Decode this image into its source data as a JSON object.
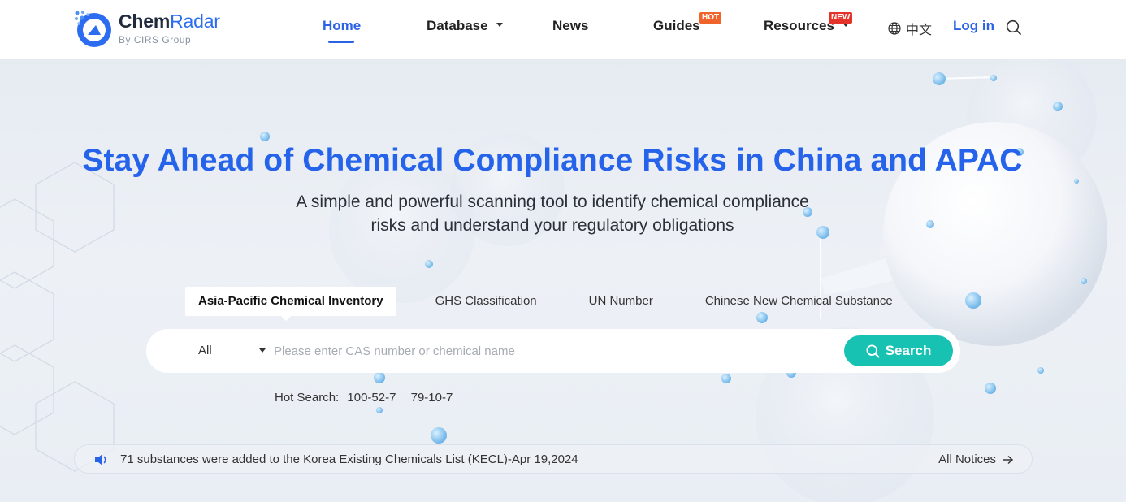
{
  "header": {
    "logo": {
      "name_bold": "Chem",
      "name_light": "Radar",
      "sub": "By CIRS Group"
    },
    "nav": {
      "home": "Home",
      "database": "Database",
      "news": "News",
      "guides": "Guides",
      "resources": "Resources"
    },
    "badges": {
      "hot": "HOT",
      "new": "NEW"
    },
    "language": "中文",
    "login": "Log in",
    "icons": {
      "globe": "globe-icon",
      "search": "search-icon",
      "dropdown": "chevron-down-icon"
    }
  },
  "hero": {
    "title": "Stay Ahead of Chemical Compliance Risks in China and APAC",
    "subtitle_line1": "A simple and powerful scanning tool to identify chemical compliance",
    "subtitle_line2": "risks and understand your regulatory obligations"
  },
  "search": {
    "tabs": [
      {
        "label": "Asia-Pacific Chemical Inventory",
        "active": true
      },
      {
        "label": "GHS Classification",
        "active": false
      },
      {
        "label": "UN Number",
        "active": false
      },
      {
        "label": "Chinese New Chemical Substance",
        "active": false
      }
    ],
    "scope_selected": "All",
    "placeholder": "Please enter CAS number or chemical name",
    "value": "",
    "button_label": "Search",
    "hot_label": "Hot Search:",
    "hot_items": [
      "100-52-7",
      "79-10-7"
    ]
  },
  "notice": {
    "text": "71 substances were added to the Korea Existing Chemicals List (KECL)-Apr 19,2024",
    "all_label": "All Notices",
    "icons": {
      "speaker": "speaker-icon",
      "arrow": "arrow-right-icon"
    }
  },
  "colors": {
    "accent": "#2563eb",
    "nav_active": "#2b63e6",
    "search_button": "#18c2b3",
    "badge_hot": "#f0632a",
    "badge_new": "#e6332a"
  }
}
